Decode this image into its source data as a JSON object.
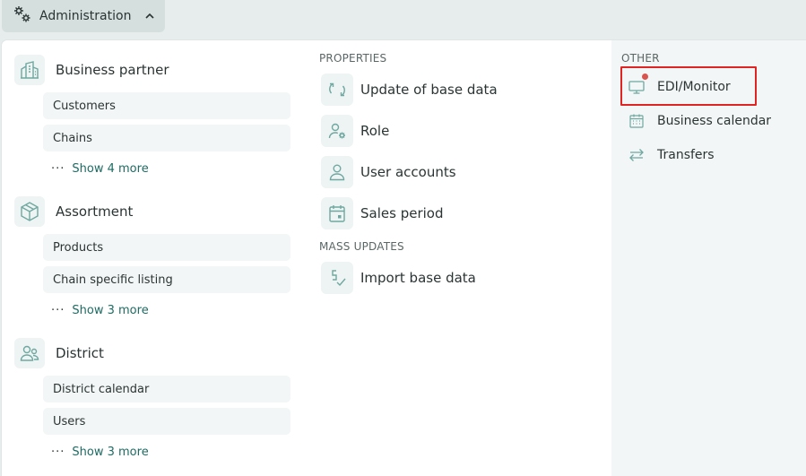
{
  "header": {
    "menu_label": "Administration"
  },
  "sections": {
    "business_partner": {
      "title": "Business partner",
      "items": [
        "Customers",
        "Chains"
      ],
      "show_more": "Show 4 more"
    },
    "assortment": {
      "title": "Assortment",
      "items": [
        "Products",
        "Chain specific listing"
      ],
      "show_more": "Show 3 more"
    },
    "district": {
      "title": "District",
      "items": [
        "District calendar",
        "Users"
      ],
      "show_more": "Show 3 more"
    }
  },
  "properties": {
    "heading": "PROPERTIES",
    "items": [
      "Update of base data",
      "Role",
      "User accounts",
      "Sales period"
    ]
  },
  "mass_updates": {
    "heading": "MASS UPDATES",
    "items": [
      "Import base data"
    ]
  },
  "other": {
    "heading": "OTHER",
    "items": [
      "EDI/Monitor",
      "Business calendar",
      "Transfers"
    ]
  },
  "icons": {
    "gears": "gears-icon",
    "chevron": "chevron-up-icon",
    "building": "building-icon",
    "box": "box-icon",
    "users": "users-icon",
    "sync": "sync-icon",
    "role": "user-gear-icon",
    "user": "user-icon",
    "calendar": "calendar-icon",
    "import": "import-icon",
    "monitor": "monitor-icon",
    "transfer": "transfer-icon"
  },
  "colors": {
    "accent": "#1f6b63",
    "icon": "#6fa8a0",
    "alert_dot": "#d9534f",
    "highlight": "#e02424"
  }
}
